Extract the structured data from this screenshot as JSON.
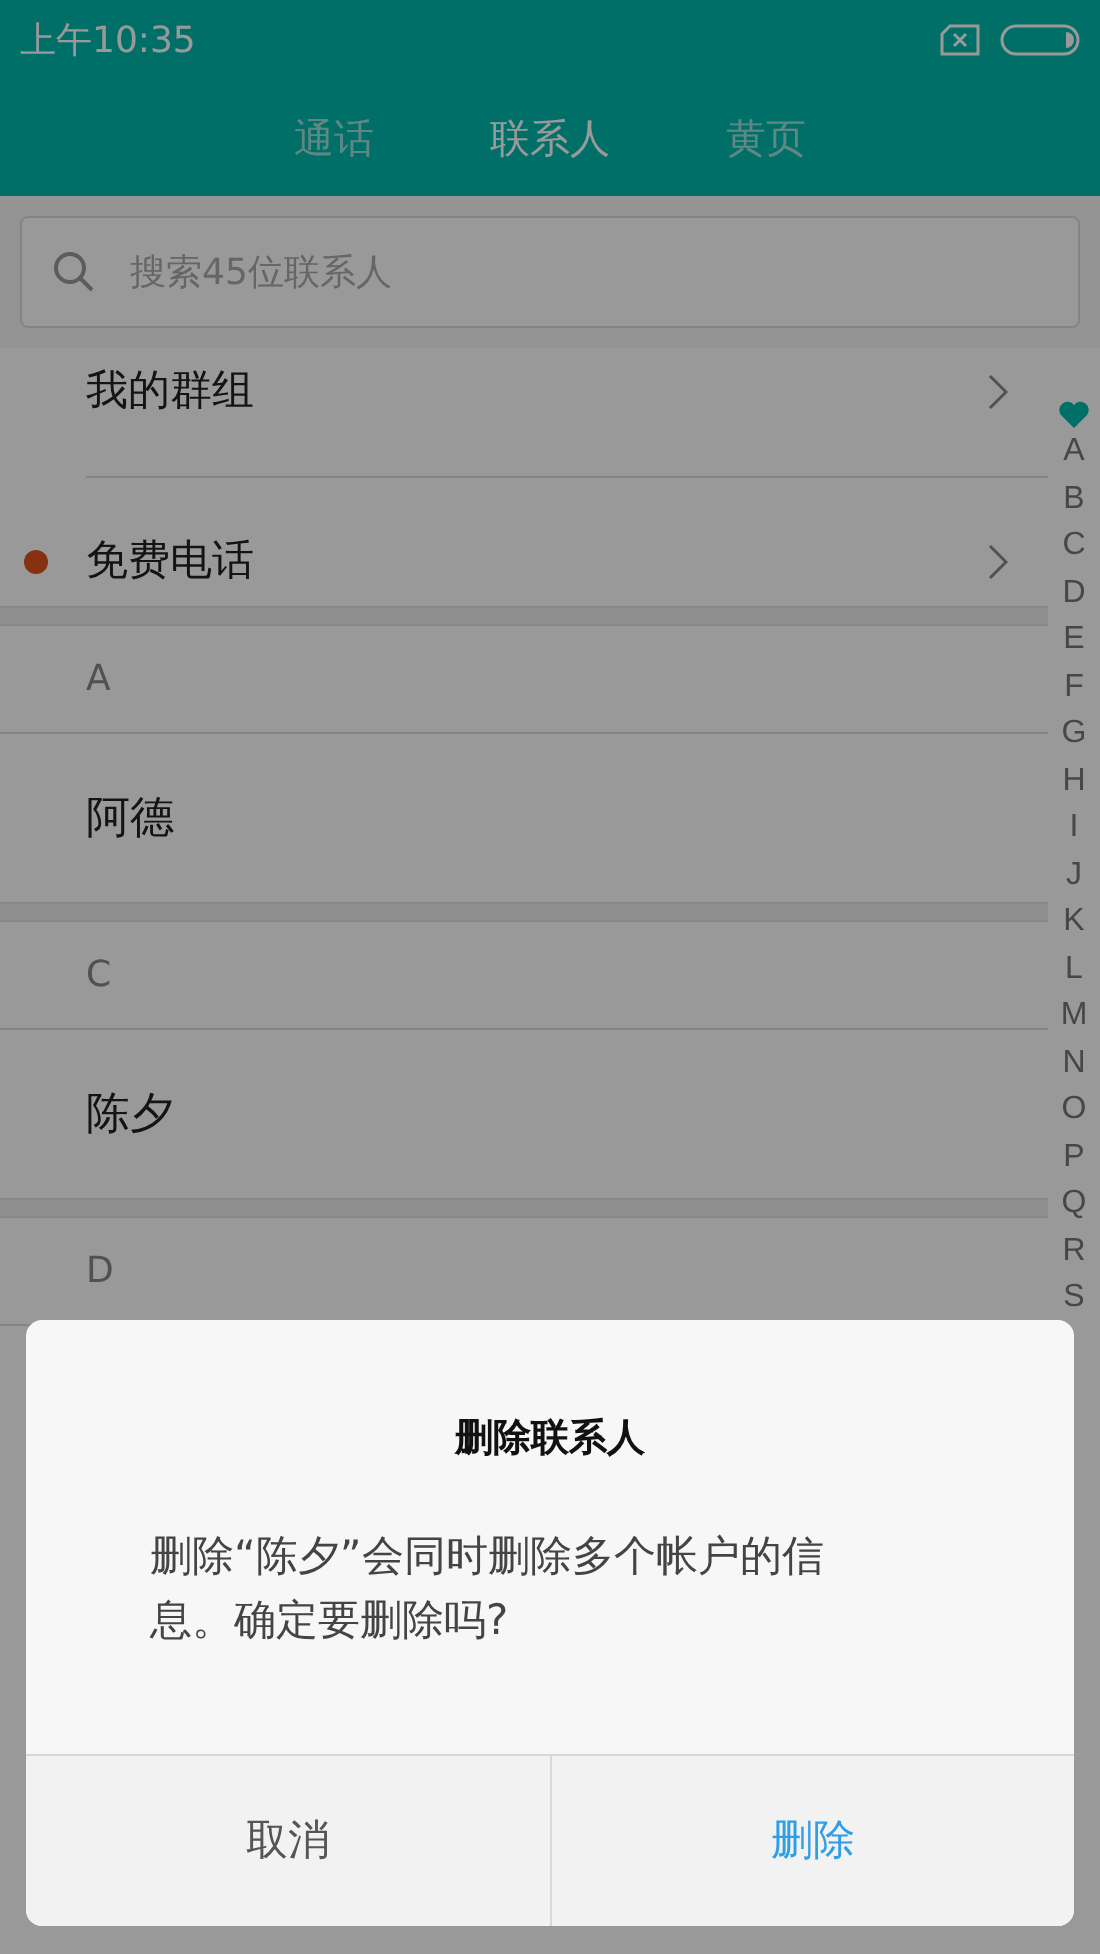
{
  "status_bar": {
    "time": "上午10:35"
  },
  "tabs": [
    {
      "label": "通话",
      "selected": false
    },
    {
      "label": "联系人",
      "selected": true
    },
    {
      "label": "黄页",
      "selected": false
    }
  ],
  "search": {
    "placeholder": "搜索45位联系人"
  },
  "list": [
    {
      "kind": "link",
      "label": "我的群组",
      "dot": false
    },
    {
      "kind": "link",
      "label": "免费电话",
      "dot": true
    },
    {
      "kind": "header",
      "label": "A"
    },
    {
      "kind": "contact",
      "label": "阿德"
    },
    {
      "kind": "header",
      "label": "C"
    },
    {
      "kind": "contact",
      "label": "陈夕"
    },
    {
      "kind": "header",
      "label": "D"
    }
  ],
  "index": [
    "A",
    "B",
    "C",
    "D",
    "E",
    "F",
    "G",
    "H",
    "I",
    "J",
    "K",
    "L",
    "M",
    "N",
    "O",
    "P",
    "Q",
    "R",
    "S"
  ],
  "dialog": {
    "title": "删除联系人",
    "message": "删除“陈夕”会同时删除多个帐户的信息。确定要删除吗?",
    "buttons": [
      {
        "label": "取消",
        "kind": "cancel"
      },
      {
        "label": "删除",
        "kind": "confirm"
      }
    ]
  }
}
